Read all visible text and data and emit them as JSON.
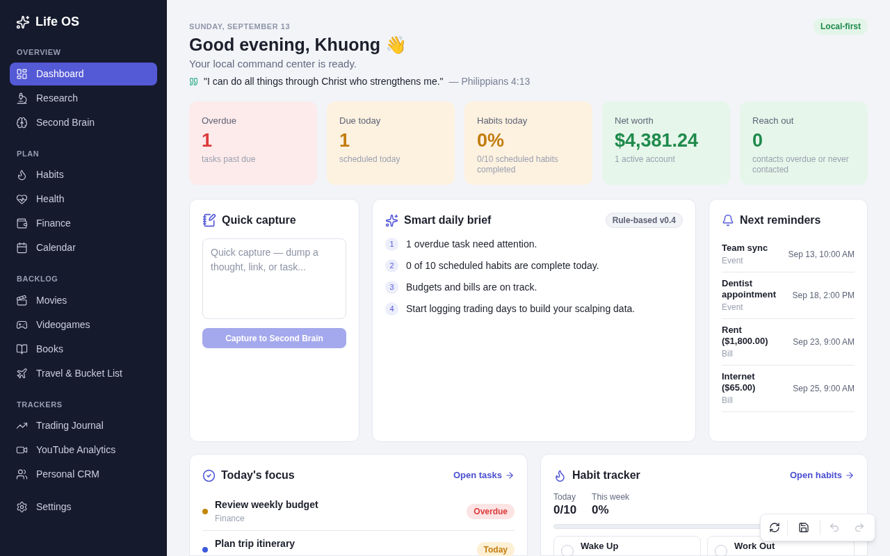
{
  "sidebar": {
    "app_name": "Life OS",
    "groups": [
      {
        "heading": "OVERVIEW",
        "items": [
          {
            "label": "Dashboard",
            "selected": true
          },
          {
            "label": "Research",
            "selected": false
          },
          {
            "label": "Second Brain",
            "selected": false
          }
        ]
      },
      {
        "heading": "PLAN",
        "items": [
          {
            "label": "Habits",
            "selected": false
          },
          {
            "label": "Health",
            "selected": false
          },
          {
            "label": "Finance",
            "selected": false
          },
          {
            "label": "Calendar",
            "selected": false
          }
        ]
      },
      {
        "heading": "BACKLOG",
        "items": [
          {
            "label": "Movies",
            "selected": false
          },
          {
            "label": "Videogames",
            "selected": false
          },
          {
            "label": "Books",
            "selected": false
          },
          {
            "label": "Travel & Bucket List",
            "selected": false
          }
        ]
      },
      {
        "heading": "TRACKERS",
        "items": [
          {
            "label": "Trading Journal",
            "selected": false
          },
          {
            "label": "YouTube Analytics",
            "selected": false
          },
          {
            "label": "Personal CRM",
            "selected": false
          }
        ]
      }
    ],
    "settings": {
      "label": "Settings",
      "selected": false
    }
  },
  "header": {
    "date": "SUNDAY, SEPTEMBER 13",
    "greeting": "Good evening, Khuong 👋",
    "subtitle": "Your local command center is ready.",
    "quote": "\"I can do all things through Christ who strengthens me.\"",
    "quote_source": "— Philippians 4:13",
    "badge": "Local-first"
  },
  "stats": [
    {
      "kind": "danger",
      "label": "Overdue",
      "value": "1",
      "note": "tasks past due"
    },
    {
      "kind": "warning",
      "label": "Due today",
      "value": "1",
      "note": "scheduled today"
    },
    {
      "kind": "warning",
      "label": "Habits today",
      "value": "0%",
      "note": "0/10 scheduled habits completed"
    },
    {
      "kind": "success",
      "label": "Net worth",
      "value": "$4,381.24",
      "note": "1 active account"
    },
    {
      "kind": "success",
      "label": "Reach out",
      "value": "0",
      "note": "contacts overdue or never contacted"
    }
  ],
  "quick_capture": {
    "title": "Quick capture",
    "placeholder": "Quick capture — dump a thought, link, or task...",
    "button": "Capture to Second Brain",
    "button_disabled": true
  },
  "daily_brief": {
    "title": "Smart daily brief",
    "badge": "Rule-based v0.4",
    "items": [
      {
        "number": "1",
        "text": "1 overdue task need attention."
      },
      {
        "number": "2",
        "text": "0 of 10 scheduled habits are complete today."
      },
      {
        "number": "3",
        "text": "Budgets and bills are on track."
      },
      {
        "number": "4",
        "text": "Start logging trading days to build your scalping data."
      }
    ]
  },
  "reminders": {
    "title": "Next reminders",
    "items": [
      {
        "name": "Team sync",
        "type": "Event",
        "when": "Sep 13, 10:00 AM"
      },
      {
        "name": "Dentist appointment",
        "type": "Event",
        "when": "Sep 18, 2:00 PM"
      },
      {
        "name": "Rent ($1,800.00)",
        "type": "Bill",
        "when": "Sep 23, 9:00 AM"
      },
      {
        "name": "Internet ($65.00)",
        "type": "Bill",
        "when": "Sep 25, 9:00 AM"
      }
    ]
  },
  "focus": {
    "title": "Today's focus",
    "link": "Open tasks",
    "tasks": [
      {
        "title": "Review weekly budget",
        "area": "Finance",
        "color": "#c2860a",
        "status": "Overdue",
        "kind": "overdue"
      },
      {
        "title": "Plan trip itinerary",
        "color": "#3b5bdb",
        "status": "Today",
        "kind": "today"
      }
    ]
  },
  "habit_tracker": {
    "title": "Habit tracker",
    "link": "Open habits",
    "today_label": "Today",
    "today_value": "0/10",
    "week_label": "This week",
    "week_value": "0%",
    "level": 0,
    "habits": [
      {
        "name": "Wake Up",
        "checked": false
      },
      {
        "name": "Work Out",
        "checked": false
      }
    ]
  },
  "toolbar": {
    "undo_disabled": true,
    "redo_disabled": true
  }
}
